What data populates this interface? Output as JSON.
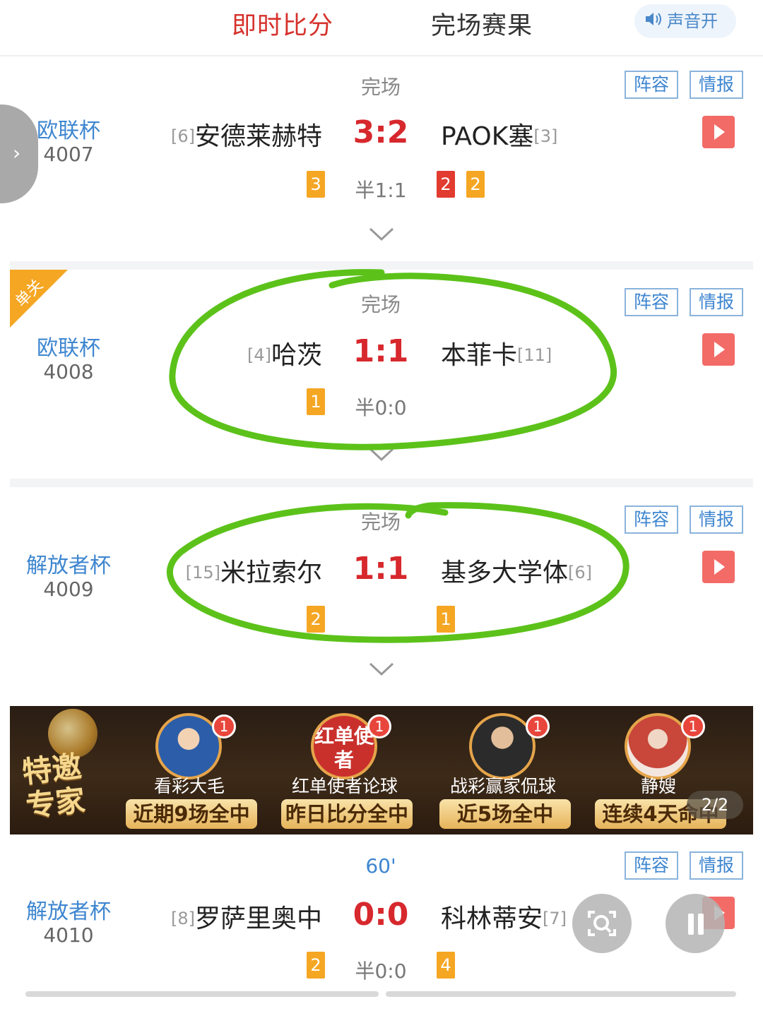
{
  "header": {
    "tabs": [
      "即时比分",
      "完场赛果"
    ],
    "sound_label": "声音开"
  },
  "matches": [
    {
      "league": "欧联杯",
      "num": "4007",
      "status": "完场",
      "home_rank": "[6]",
      "home": "安德莱赫特",
      "score": "3:2",
      "away": "PAOK塞",
      "away_rank": "[3]",
      "half": "半1:1",
      "home_cards": [
        {
          "type": "yellow",
          "n": "3"
        }
      ],
      "away_cards": [
        {
          "type": "red",
          "n": "2"
        },
        {
          "type": "yellow",
          "n": "2"
        }
      ],
      "lineup": "阵容",
      "intel": "情报"
    },
    {
      "league": "欧联杯",
      "num": "4008",
      "status": "完场",
      "corner_tag": "单关",
      "home_rank": "[4]",
      "home": "哈茨",
      "score": "1:1",
      "away": "本菲卡",
      "away_rank": "[11]",
      "half": "半0:0",
      "home_cards": [
        {
          "type": "yellow",
          "n": "1"
        }
      ],
      "away_cards": [],
      "lineup": "阵容",
      "intel": "情报"
    },
    {
      "league": "解放者杯",
      "num": "4009",
      "status": "完场",
      "home_rank": "[15]",
      "home": "米拉索尔",
      "score": "1:1",
      "away": "基多大学体",
      "away_rank": "[6]",
      "half": "",
      "home_cards": [
        {
          "type": "yellow",
          "n": "2"
        }
      ],
      "away_cards": [
        {
          "type": "yellow",
          "n": "1"
        }
      ],
      "lineup": "阵容",
      "intel": "情报"
    },
    {
      "league": "解放者杯",
      "num": "4010",
      "status": "60'",
      "home_rank": "[8]",
      "home": "罗萨里奥中",
      "score": "0:0",
      "away": "科林蒂安",
      "away_rank": "[7]",
      "half": "半0:0",
      "home_cards": [
        {
          "type": "yellow",
          "n": "2"
        }
      ],
      "away_cards": [
        {
          "type": "yellow",
          "n": "4"
        }
      ],
      "lineup": "阵容",
      "intel": "情报"
    }
  ],
  "banner": {
    "title_line1": "特邀",
    "title_line2": "专家",
    "experts": [
      {
        "name": "看彩大毛",
        "tag": "近期9场全中",
        "badge": "1"
      },
      {
        "name": "红单使者论球",
        "tag": "昨日比分全中",
        "badge": "1",
        "avatar_text": "红单使者"
      },
      {
        "name": "战彩赢家侃球",
        "tag": "近5场全中",
        "badge": "1"
      },
      {
        "name": "静嫂",
        "tag": "连续4天命中",
        "badge": "1"
      }
    ],
    "pager": "2/2"
  },
  "colors": {
    "accent_red": "#d7282d",
    "link_blue": "#3e86d0",
    "annotation_green": "#5cc21a",
    "yellow_card": "#f5a623",
    "red_card": "#e23b2f"
  }
}
